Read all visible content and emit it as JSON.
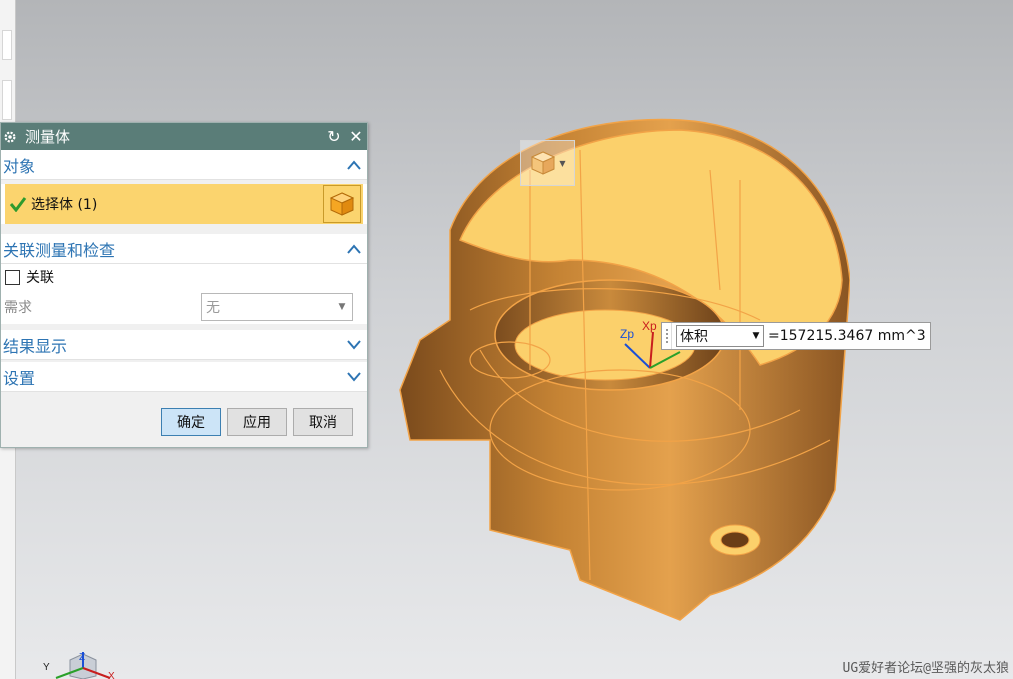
{
  "dialog": {
    "title": "测量体",
    "sections": {
      "object": {
        "label": "对象",
        "select_label": "选择体 (1)"
      },
      "related": {
        "label": "关联测量和检查",
        "associate_label": "关联",
        "requirement_label": "需求",
        "requirement_value": "无"
      },
      "results": {
        "label": "结果显示"
      },
      "settings": {
        "label": "设置"
      }
    },
    "buttons": {
      "ok": "确定",
      "apply": "应用",
      "cancel": "取消"
    }
  },
  "viewport": {
    "measure": {
      "type": "体积",
      "value": "=157215.3467 mm^3"
    },
    "axes": {
      "zp": "Zp",
      "xp": "Xp"
    },
    "triad": {
      "y": "Y",
      "z": "Z",
      "x": "X"
    },
    "watermark": "UG爱好者论坛@坚强的灰太狼"
  },
  "colors": {
    "title_bar": "#5a7d78",
    "section_text": "#2d74b3",
    "selection_bg": "#fbd46e",
    "part_fill": "#c9852e",
    "part_edge": "#f2a347"
  }
}
